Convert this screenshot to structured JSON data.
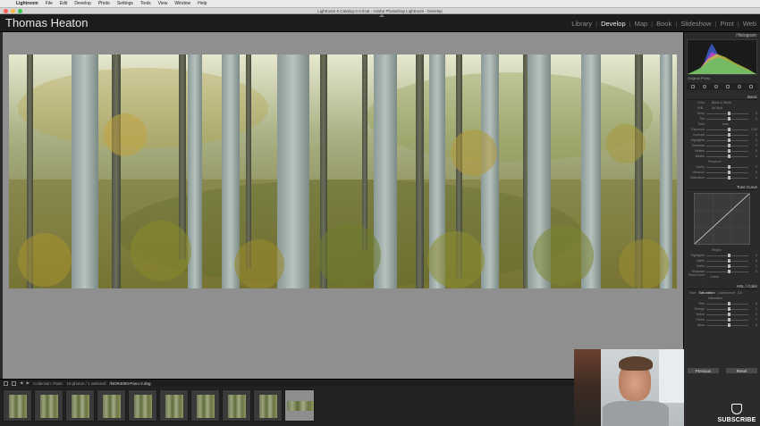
{
  "menubar": {
    "items": [
      "Lightroom",
      "File",
      "Edit",
      "Develop",
      "Photo",
      "Settings",
      "Tools",
      "View",
      "Window",
      "Help"
    ]
  },
  "window": {
    "title": "Lightroom 6 Catalog-2-2.lrcat - Adobe Photoshop Lightroom - Develop"
  },
  "identity_plate": "Thomas Heaton",
  "modules": [
    {
      "label": "Library",
      "active": false
    },
    {
      "label": "Develop",
      "active": true
    },
    {
      "label": "Map",
      "active": false
    },
    {
      "label": "Book",
      "active": false
    },
    {
      "label": "Slideshow",
      "active": false
    },
    {
      "label": "Print",
      "active": false
    },
    {
      "label": "Web",
      "active": false
    }
  ],
  "right_panel": {
    "histogram_title": "Histogram",
    "original_photo": "Original Photo",
    "basic": {
      "title": "Basic",
      "treatment_color": "Color",
      "treatment_bw": "Black & White",
      "wb": "WB :",
      "wb_value": "As Shot",
      "tone": "Tone",
      "tone_auto": "Auto",
      "sliders": [
        {
          "label": "Temp",
          "value": "0"
        },
        {
          "label": "Tint",
          "value": "0"
        },
        {
          "label": "Exposure",
          "value": "0.00"
        },
        {
          "label": "Contrast",
          "value": "0"
        },
        {
          "label": "Highlights",
          "value": "0"
        },
        {
          "label": "Shadows",
          "value": "0"
        },
        {
          "label": "Whites",
          "value": "0"
        },
        {
          "label": "Blacks",
          "value": "0"
        }
      ],
      "presence": "Presence",
      "presence_sliders": [
        {
          "label": "Clarity",
          "value": "0"
        },
        {
          "label": "Vibrance",
          "value": "0"
        },
        {
          "label": "Saturation",
          "value": "0"
        }
      ]
    },
    "tone_curve_title": "Tone Curve",
    "region": "Region",
    "curve_sliders": [
      {
        "label": "Highlights",
        "value": "0"
      },
      {
        "label": "Lights",
        "value": "0"
      },
      {
        "label": "Darks",
        "value": "0"
      },
      {
        "label": "Shadows",
        "value": "0"
      }
    ],
    "point_curve": "Point Curve :",
    "point_curve_value": "Linear",
    "hsl_title": "HSL / Color",
    "hsl_tabs": [
      "Hue",
      "Saturation",
      "Luminance",
      "All"
    ],
    "hsl_section": "Saturation",
    "hsl_sliders": [
      {
        "label": "Red",
        "value": "0"
      },
      {
        "label": "Orange",
        "value": "0"
      },
      {
        "label": "Yellow",
        "value": "0"
      },
      {
        "label": "Green",
        "value": "0"
      },
      {
        "label": "Aqua",
        "value": "0"
      }
    ],
    "previous_button": "Previous",
    "reset_button": "Reset"
  },
  "filmstrip": {
    "collection": "Collection: Panic",
    "selection": "19 photos / 1 selected",
    "filename": "/NOR4093-Pano-2.dng",
    "thumb_count": 10,
    "selected_index": 9
  },
  "subscribe_label": "SUBSCRIBE",
  "colors": {
    "canvas": "#8f8f8f",
    "panel": "#2b2b2b",
    "active_module": "#f0f0f0",
    "inactive_module": "#8c8c8c"
  }
}
